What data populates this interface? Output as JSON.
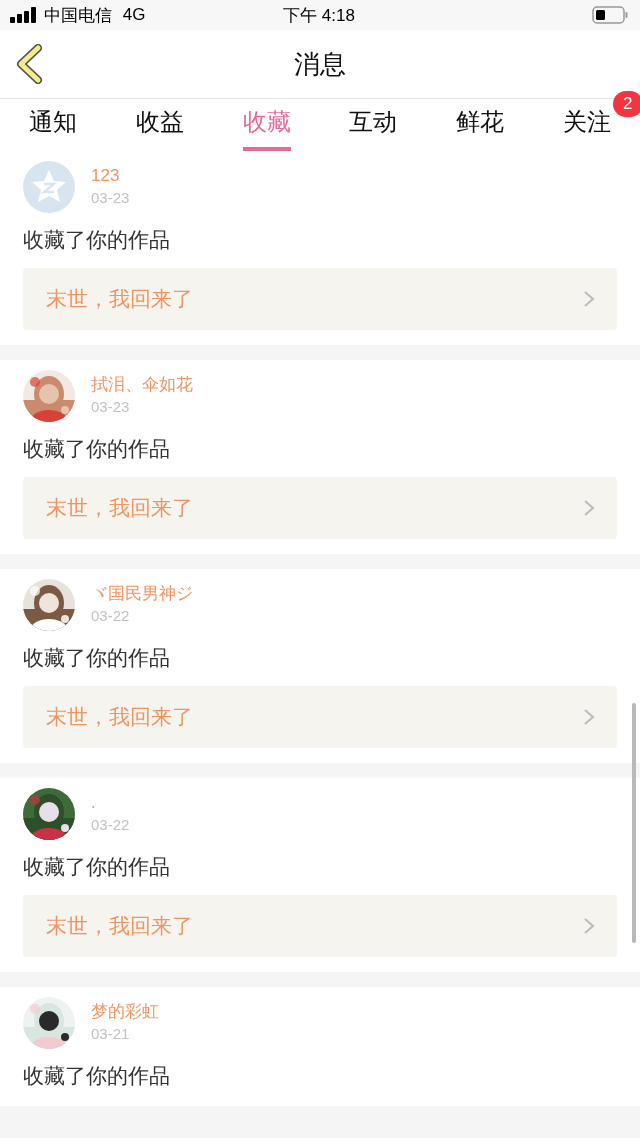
{
  "status_bar": {
    "carrier": "中国电信",
    "network": "4G",
    "time": "下午 4:18"
  },
  "header": {
    "title": "消息"
  },
  "tabs": [
    {
      "label": "通知",
      "selected": false
    },
    {
      "label": "收益",
      "selected": false
    },
    {
      "label": "收藏",
      "selected": true
    },
    {
      "label": "互动",
      "selected": false
    },
    {
      "label": "鲜花",
      "selected": false
    },
    {
      "label": "关注",
      "selected": false,
      "badge": "2"
    }
  ],
  "messages": [
    {
      "avatar": {
        "kind": "default"
      },
      "name": "123",
      "date": "03-23",
      "action": "收藏了你的作品",
      "work": "末世，我回来了"
    },
    {
      "name": "拭泪、伞如花",
      "date": "03-23",
      "action": "收藏了你的作品",
      "work": "末世，我回来了"
    },
    {
      "name": "ヾ国民男神ジ",
      "date": "03-22",
      "action": "收藏了你的作品",
      "work": "末世，我回来了"
    },
    {
      "name": ".",
      "date": "03-22",
      "action": "收藏了你的作品",
      "work": "末世，我回来了"
    },
    {
      "name": "梦的彩虹",
      "date": "03-21",
      "action": "收藏了你的作品"
    }
  ]
}
